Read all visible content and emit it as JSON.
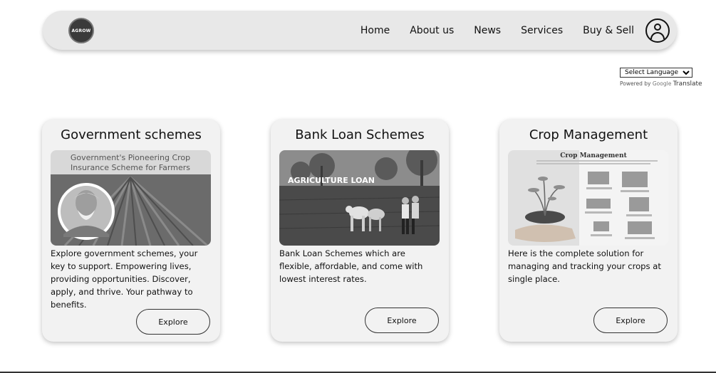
{
  "nav": {
    "logo_text": "AGROW",
    "links": [
      "Home",
      "About us",
      "News",
      "Services",
      "Buy & Sell"
    ]
  },
  "translate": {
    "select_label": "Select Language",
    "powered_by": "Powered by",
    "google": "Google",
    "translate": "Translate"
  },
  "cards": [
    {
      "title": "Government schemes",
      "image_caption_line1": "Government's Pioneering Crop",
      "image_caption_line2": "Insurance Scheme for Farmers",
      "description": "Explore government schemes, your key to support. Empowering lives, providing opportunities. Discover, apply, and thrive. Your pathway to benefits.",
      "button": "Explore"
    },
    {
      "title": "Bank Loan Schemes",
      "image_caption": "AGRICULTURE LOAN",
      "description": "Bank Loan Schemes which are flexible, affordable, and come with lowest interest rates.",
      "button": "Explore"
    },
    {
      "title": "Crop Management",
      "image_caption": "Crop Management",
      "description": "Here is the complete solution for managing and tracking your crops at single place.",
      "button": "Explore"
    }
  ]
}
